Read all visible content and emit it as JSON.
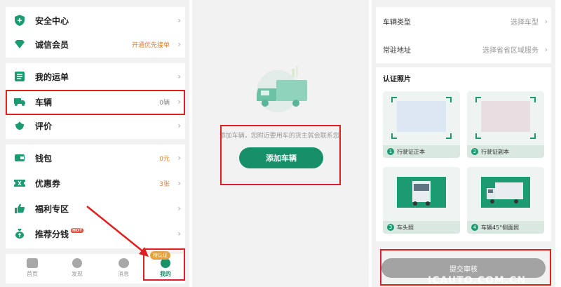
{
  "menu": {
    "items": [
      {
        "label": "安全中心",
        "value": "",
        "icon": "shield-icon"
      },
      {
        "label": "诚信会员",
        "value": "开通优先接单",
        "icon": "diamond-icon"
      },
      {
        "label": "我的运单",
        "value": "",
        "icon": "list-icon"
      },
      {
        "label": "车辆",
        "value": "0辆",
        "icon": "truck-icon"
      },
      {
        "label": "评价",
        "value": "",
        "icon": "rating-icon"
      },
      {
        "label": "钱包",
        "value": "0元",
        "icon": "wallet-icon"
      },
      {
        "label": "优惠券",
        "value": "3张",
        "icon": "coupon-icon"
      },
      {
        "label": "福利专区",
        "value": "",
        "icon": "thumb-up-icon"
      },
      {
        "label": "推荐分钱",
        "value": "",
        "icon": "money-bag-icon",
        "badge": "HOT"
      }
    ]
  },
  "tabbar": {
    "tabs": [
      {
        "label": "首页"
      },
      {
        "label": "发现"
      },
      {
        "label": "消息"
      },
      {
        "label": "我的"
      }
    ],
    "badge": "待认证"
  },
  "vehicle": {
    "empty_hint": "添加车辆，您附近要用车的货主就会联系您!",
    "add_button": "添加车辆"
  },
  "form": {
    "vehicle_type_label": "车辆类型",
    "vehicle_type_value": "选择车型",
    "address_label": "常驻地址",
    "address_value": "选择省省区域服务"
  },
  "photos": {
    "title": "认证照片",
    "items": [
      {
        "num": "1",
        "caption": "行驶证正本"
      },
      {
        "num": "2",
        "caption": "行驶证副本"
      },
      {
        "num": "3",
        "caption": "车头照"
      },
      {
        "num": "4",
        "caption": "车辆45°侧面照"
      }
    ]
  },
  "submit_button": "提交审核",
  "watermark": "ICAUTO.COM.CN",
  "colors": {
    "brand_green": "#17906a",
    "highlight_red": "#e02020",
    "orange": "#e0822a"
  }
}
